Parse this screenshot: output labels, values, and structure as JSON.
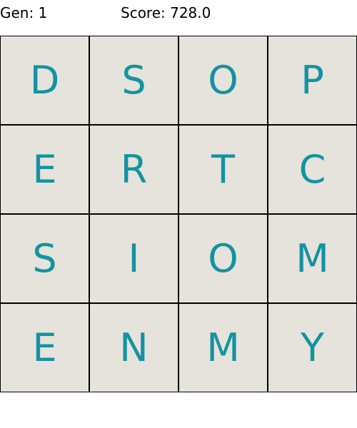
{
  "status": {
    "gen": "Gen: 1",
    "score": "Score: 728.0"
  },
  "colors": {
    "tile_background": "#e5e3dc",
    "letter": "#1393a2",
    "grid_lines": "#000000"
  },
  "board": {
    "rows": [
      [
        "D",
        "S",
        "O",
        "P"
      ],
      [
        "E",
        "R",
        "T",
        "C"
      ],
      [
        "S",
        "I",
        "O",
        "M"
      ],
      [
        "E",
        "N",
        "M",
        "Y"
      ]
    ]
  }
}
